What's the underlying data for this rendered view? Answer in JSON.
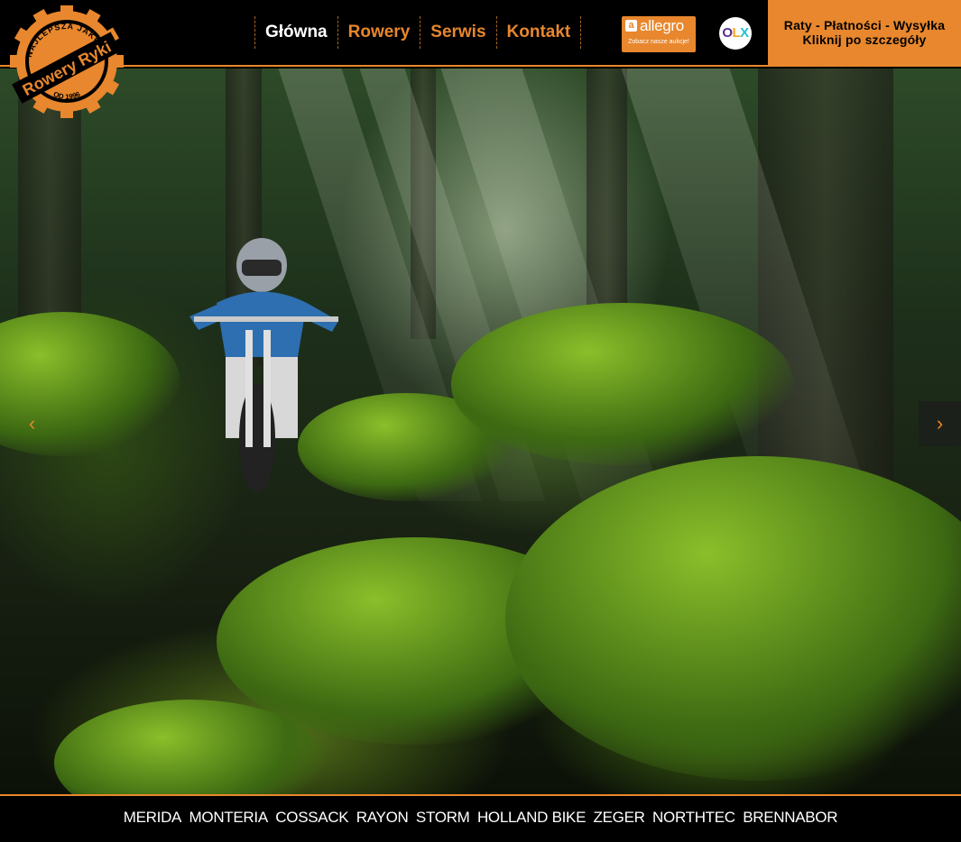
{
  "logo": {
    "name": "Rowery Ryki",
    "tagline": "NAJLEPSZA JAKOŚĆ",
    "since": "OD 1996",
    "color": "#e8872d"
  },
  "nav": {
    "items": [
      {
        "label": "Główna",
        "active": true
      },
      {
        "label": "Rowery",
        "active": false
      },
      {
        "label": "Serwis",
        "active": false
      },
      {
        "label": "Kontakt",
        "active": false
      }
    ]
  },
  "allegro": {
    "icon": "a",
    "name": "allegro",
    "sub": "Zobacz nasze aukcje!"
  },
  "olx": {
    "o": "O",
    "l": "L",
    "x": "X"
  },
  "promo": {
    "line1": "Raty - Płatności - Wysyłka",
    "line2": "Kliknij po szczegóły"
  },
  "slider": {
    "prev_icon": "chevron-left-icon",
    "next_icon": "chevron-right-icon",
    "prev_glyph": "‹",
    "next_glyph": "›"
  },
  "brands": [
    "MERIDA",
    "MONTERIA",
    "COSSACK",
    "RAYON",
    "STORM",
    "HOLLAND BIKE",
    "ZEGER",
    "NORTHTEC",
    "BRENNABOR"
  ],
  "colors": {
    "accent": "#e8872d",
    "background": "#000000"
  }
}
